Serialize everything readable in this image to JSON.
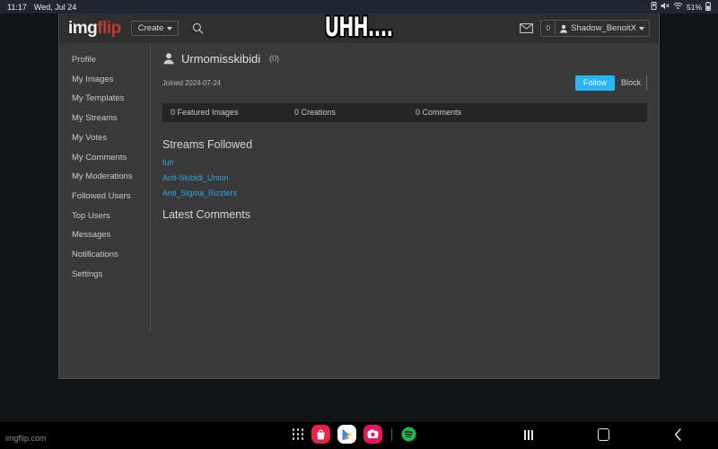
{
  "status_bar": {
    "time": "11:17",
    "date": "Wed, Jul 24",
    "battery": "51%",
    "icons": [
      "vibrate-icon",
      "mute-icon",
      "wifi-icon",
      "battery-icon"
    ]
  },
  "meme": {
    "caption": "UHH...."
  },
  "header": {
    "logo_part1": "img",
    "logo_part2": "flip",
    "create_label": "Create",
    "search_icon": "search-icon",
    "mail_icon": "envelope-icon",
    "notification_count": "0",
    "user_name": "Shadow_BenoitX",
    "user_icon": "user-avatar-icon"
  },
  "sidebar": {
    "items": [
      {
        "label": "Profile"
      },
      {
        "label": "My Images"
      },
      {
        "label": "My Templates"
      },
      {
        "label": "My Streams"
      },
      {
        "label": "My Votes"
      },
      {
        "label": "My Comments"
      },
      {
        "label": "My Moderations"
      },
      {
        "label": "Followed Users"
      },
      {
        "label": "Top Users"
      },
      {
        "label": "Messages"
      },
      {
        "label": "Notifications"
      },
      {
        "label": "Settings"
      }
    ]
  },
  "profile": {
    "name": "Urmomisskibidi",
    "count": "(0)",
    "joined": "Joined 2024-07-24",
    "follow_label": "Follow",
    "block_label": "Block",
    "follow_color": "#29b6f6",
    "stats": [
      "0 Featured Images",
      "0 Creations",
      "0 Comments"
    ]
  },
  "streams": {
    "title": "Streams Followed",
    "link_color": "#2ba6d8",
    "items": [
      {
        "label": "fun"
      },
      {
        "label": "Anti-Skibidi_Union"
      },
      {
        "label": "Anti_Sigma_Rizzlers"
      }
    ]
  },
  "comments": {
    "title": "Latest Comments"
  },
  "footer": {
    "watermark": "imgflip.com"
  },
  "dock": {
    "items": [
      {
        "name": "apps-grid-icon"
      },
      {
        "name": "shopping-bag-app-icon",
        "color": "#e8234a"
      },
      {
        "name": "google-play-icon",
        "color": "#ffffff"
      },
      {
        "name": "instagram-app-icon",
        "color": "#e8175d"
      },
      {
        "name": "spotify-icon",
        "color": "#1db954"
      }
    ]
  },
  "system_nav": {
    "recents": "recents-icon",
    "home": "home-icon",
    "back": "back-icon"
  }
}
